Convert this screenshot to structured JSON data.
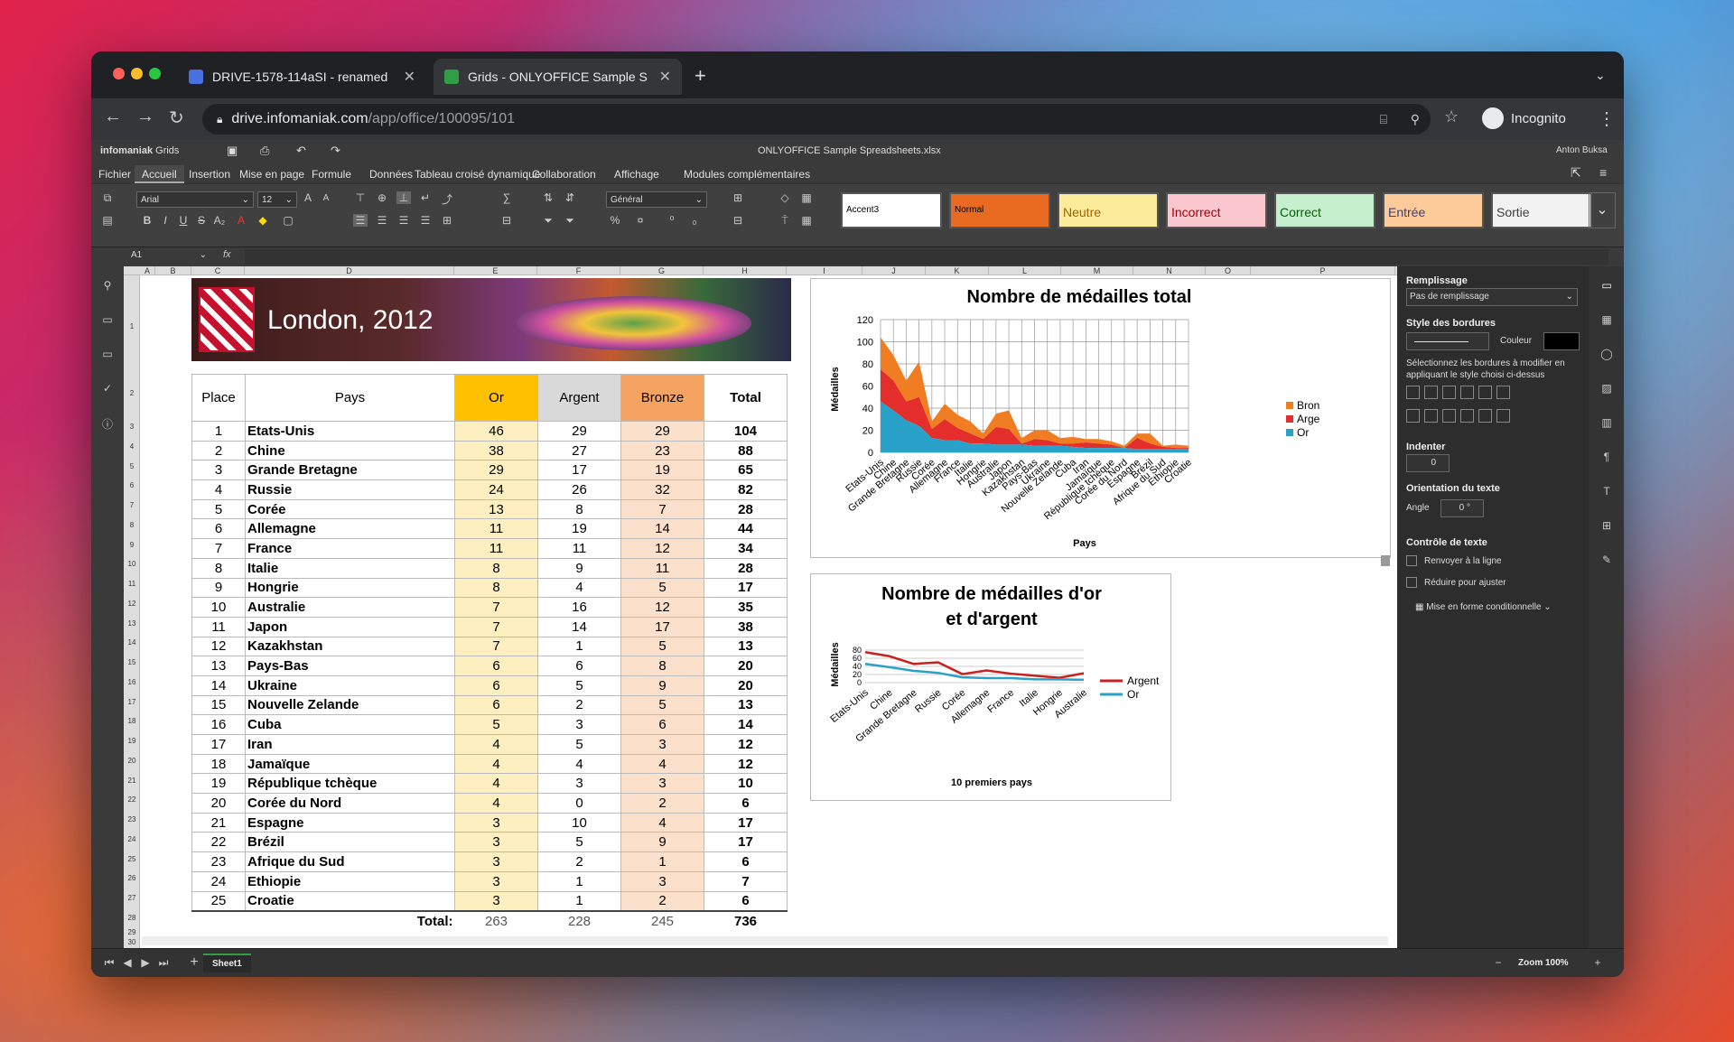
{
  "browser": {
    "tabs": [
      {
        "label": "DRIVE-1578-114aSI - renamed"
      },
      {
        "label": "Grids - ONLYOFFICE Sample S"
      }
    ],
    "url_host": "drive.infomaniak.com",
    "url_path": "/app/office/100095/101",
    "profile": "Incognito"
  },
  "app": {
    "brand": "infomaniak",
    "product": "Grids",
    "doc_title": "ONLYOFFICE Sample Spreadsheets.xlsx",
    "user": "Anton Buksa",
    "menus": [
      "Fichier",
      "Accueil",
      "Insertion",
      "Mise en page",
      "Formule",
      "Données",
      "Tableau croisé dynamique",
      "Collaboration",
      "Affichage",
      "Modules complémentaires"
    ],
    "active_menu": "Accueil",
    "font_name": "Arial",
    "font_size": "12",
    "number_format": "Général",
    "cell_styles": [
      {
        "label": "Accent3",
        "bg": "#ffffff",
        "fg": "#000000"
      },
      {
        "label": "Normal",
        "bg": "#e96b22",
        "fg": "#000000"
      },
      {
        "label": "Neutre",
        "bg": "#fdeb9c",
        "fg": "#9c6500"
      },
      {
        "label": "Incorrect",
        "bg": "#fbc7ce",
        "fg": "#9c0006"
      },
      {
        "label": "Correct",
        "bg": "#c6efce",
        "fg": "#006100"
      },
      {
        "label": "Entrée",
        "bg": "#fdcb9a",
        "fg": "#3f3f76"
      },
      {
        "label": "Sortie",
        "bg": "#f2f2f2",
        "fg": "#3f3f3f"
      }
    ],
    "cell_ref": "A1",
    "fx": "fx",
    "sheet_tab": "Sheet1",
    "zoom": "Zoom 100%"
  },
  "sheet": {
    "columns": [
      "A",
      "B",
      "C",
      "D",
      "E",
      "F",
      "G",
      "H",
      "I",
      "J",
      "K",
      "L",
      "M",
      "N",
      "O",
      "P"
    ],
    "banner_title": "London, 2012",
    "headers": {
      "place": "Place",
      "pays": "Pays",
      "or": "Or",
      "argent": "Argent",
      "bronze": "Bronze",
      "total": "Total"
    },
    "rows": [
      [
        "1",
        "Etats-Unis",
        "46",
        "29",
        "29",
        "104"
      ],
      [
        "2",
        "Chine",
        "38",
        "27",
        "23",
        "88"
      ],
      [
        "3",
        "Grande Bretagne",
        "29",
        "17",
        "19",
        "65"
      ],
      [
        "4",
        "Russie",
        "24",
        "26",
        "32",
        "82"
      ],
      [
        "5",
        "Corée",
        "13",
        "8",
        "7",
        "28"
      ],
      [
        "6",
        "Allemagne",
        "11",
        "19",
        "14",
        "44"
      ],
      [
        "7",
        "France",
        "11",
        "11",
        "12",
        "34"
      ],
      [
        "8",
        "Italie",
        "8",
        "9",
        "11",
        "28"
      ],
      [
        "9",
        "Hongrie",
        "8",
        "4",
        "5",
        "17"
      ],
      [
        "10",
        "Australie",
        "7",
        "16",
        "12",
        "35"
      ],
      [
        "11",
        "Japon",
        "7",
        "14",
        "17",
        "38"
      ],
      [
        "12",
        "Kazakhstan",
        "7",
        "1",
        "5",
        "13"
      ],
      [
        "13",
        "Pays-Bas",
        "6",
        "6",
        "8",
        "20"
      ],
      [
        "14",
        "Ukraine",
        "6",
        "5",
        "9",
        "20"
      ],
      [
        "15",
        "Nouvelle Zelande",
        "6",
        "2",
        "5",
        "13"
      ],
      [
        "16",
        "Cuba",
        "5",
        "3",
        "6",
        "14"
      ],
      [
        "17",
        "Iran",
        "4",
        "5",
        "3",
        "12"
      ],
      [
        "18",
        "Jamaïque",
        "4",
        "4",
        "4",
        "12"
      ],
      [
        "19",
        "République tchèque",
        "4",
        "3",
        "3",
        "10"
      ],
      [
        "20",
        "Corée du Nord",
        "4",
        "0",
        "2",
        "6"
      ],
      [
        "21",
        "Espagne",
        "3",
        "10",
        "4",
        "17"
      ],
      [
        "22",
        "Brézil",
        "3",
        "5",
        "9",
        "17"
      ],
      [
        "23",
        "Afrique du Sud",
        "3",
        "2",
        "1",
        "6"
      ],
      [
        "24",
        "Ethiopie",
        "3",
        "1",
        "3",
        "7"
      ],
      [
        "25",
        "Croatie",
        "3",
        "1",
        "2",
        "6"
      ]
    ],
    "total_label": "Total:",
    "totals": [
      "263",
      "228",
      "245",
      "736"
    ]
  },
  "chart_data": [
    {
      "type": "area",
      "title": "Nombre de médailles total",
      "xlabel": "Pays",
      "ylabel": "Médailles",
      "ylim": [
        0,
        120
      ],
      "yticks": [
        "0",
        "20",
        "40",
        "60",
        "80",
        "100",
        "120"
      ],
      "categories": [
        "Etats-Unis",
        "Chine",
        "Grande Bretagne",
        "Russie",
        "Corée",
        "Allemagne",
        "France",
        "Italie",
        "Hongrie",
        "Australie",
        "Japon",
        "Kazakhstan",
        "Pays-Bas",
        "Ukraine",
        "Nouvelle Zelande",
        "Cuba",
        "Iran",
        "Jamaïque",
        "République tchèque",
        "Corée du Nord",
        "Espagne",
        "Brézil",
        "Afrique du Sud",
        "Ethiopie",
        "Croatie"
      ],
      "series": [
        {
          "name": "Or",
          "color": "#2aa1c8",
          "values": [
            46,
            38,
            29,
            24,
            13,
            11,
            11,
            8,
            8,
            7,
            7,
            7,
            6,
            6,
            6,
            5,
            4,
            4,
            4,
            4,
            3,
            3,
            3,
            3,
            3
          ]
        },
        {
          "name": "Argent",
          "color": "#e42e2b",
          "values": [
            29,
            27,
            17,
            26,
            8,
            19,
            11,
            9,
            4,
            16,
            14,
            1,
            6,
            5,
            2,
            3,
            5,
            4,
            3,
            0,
            10,
            5,
            2,
            1,
            1
          ]
        },
        {
          "name": "Bronze",
          "color": "#f07d22",
          "values": [
            29,
            23,
            19,
            32,
            7,
            14,
            12,
            11,
            5,
            12,
            17,
            5,
            8,
            9,
            5,
            6,
            3,
            4,
            3,
            2,
            4,
            9,
            1,
            3,
            2
          ]
        }
      ],
      "legend_labels": [
        "Bron",
        "Arge",
        "Or"
      ],
      "legend": "right"
    },
    {
      "type": "line",
      "title_line1": "Nombre de médailles d'or",
      "title_line2": "et d'argent",
      "xlabel": "10 premiers pays",
      "ylabel": "Médailles",
      "ylim": [
        0,
        80
      ],
      "yticks": [
        "0",
        "20",
        "40",
        "60",
        "80"
      ],
      "categories": [
        "Etats-Unis",
        "Chine",
        "Grande Bretagne",
        "Russie",
        "Corée",
        "Allemagne",
        "France",
        "Italie",
        "Hongrie",
        "Australie"
      ],
      "series": [
        {
          "name": "Argent",
          "color": "#c9211e",
          "values": [
            75,
            65,
            46,
            50,
            21,
            30,
            22,
            17,
            12,
            23
          ]
        },
        {
          "name": "Or",
          "color": "#2aa1c8",
          "values": [
            46,
            38,
            29,
            24,
            13,
            11,
            11,
            8,
            8,
            7
          ]
        }
      ],
      "legend": "right"
    }
  ],
  "panel": {
    "fill_label": "Remplissage",
    "fill_value": "Pas de remplissage",
    "border_label": "Style des bordures",
    "color_label": "Couleur",
    "border_hint": "Sélectionnez les bordures à modifier en appliquant le style choisi ci-dessus",
    "indent_label": "Indenter",
    "indent_value": "0",
    "orient_label": "Orientation du texte",
    "angle_label": "Angle",
    "angle_value": "0 °",
    "control_label": "Contrôle de texte",
    "wrap_label": "Renvoyer à la ligne",
    "shrink_label": "Réduire pour ajuster",
    "cond_label": "Mise en forme conditionnelle"
  }
}
